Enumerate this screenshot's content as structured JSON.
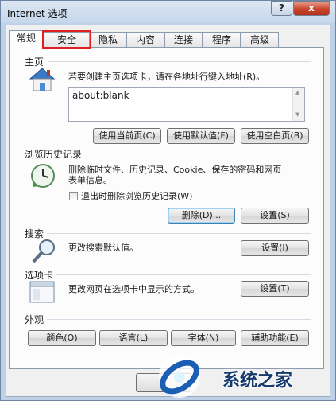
{
  "window": {
    "title": "Internet 选项",
    "help": "?",
    "close": "x"
  },
  "tabs": [
    "常规",
    "安全",
    "隐私",
    "内容",
    "连接",
    "程序",
    "高级"
  ],
  "home": {
    "label": "主页",
    "desc": "若要创建主页选项卡，请在各地址行键入地址(R)。",
    "address": "about:blank",
    "buttons": [
      "使用当前页(C)",
      "使用默认值(F)",
      "使用空白页(B)"
    ]
  },
  "history": {
    "label": "浏览历史记录",
    "desc1": "删除临时文件、历史记录、Cookie、保存的密码和网页",
    "desc2": "表单信息。",
    "checkbox": "退出时删除浏览历史记录(W)",
    "delete": "删除(D)...",
    "settings": "设置(S)"
  },
  "search": {
    "label": "搜索",
    "desc": "更改搜索默认值。",
    "settings": "设置(I)"
  },
  "tabsSec": {
    "label": "选项卡",
    "desc": "更改网页在选项卡中显示的方式。",
    "settings": "设置(T)"
  },
  "appearance": {
    "label": "外观",
    "buttons": [
      "颜色(O)",
      "语言(L)",
      "字体(N)",
      "辅助功能(E)"
    ]
  },
  "watermark": {
    "text": "系统之家"
  },
  "colors": {
    "highlight": "#e02020",
    "accent": "#1a5fb4"
  }
}
